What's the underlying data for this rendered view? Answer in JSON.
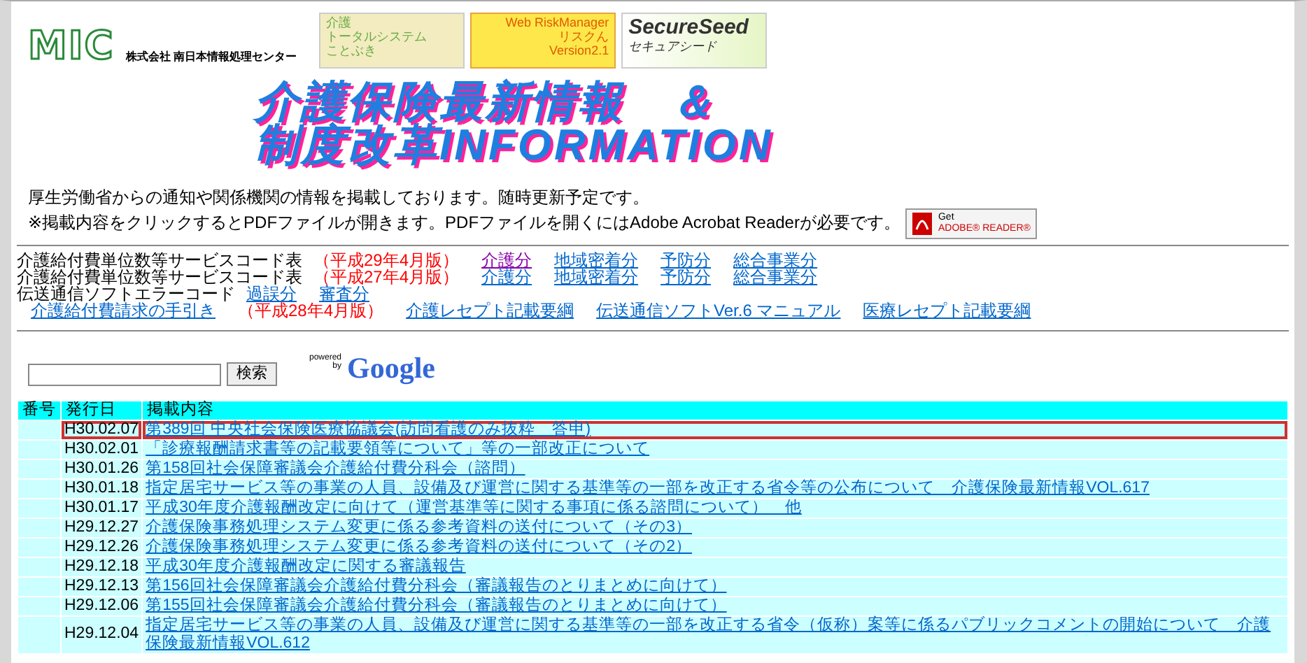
{
  "header": {
    "logo": "MIC",
    "company": "株式会社 南日本情報処理センター",
    "banners": [
      {
        "kind": "care",
        "lines": [
          "介護",
          "トータルシステム",
          "ことぶき"
        ]
      },
      {
        "kind": "risk",
        "lines": [
          "Web RiskManager",
          "リスクん",
          "Version2.1"
        ]
      },
      {
        "kind": "secure",
        "lines": [
          "SecureSeed",
          "セキュアシード"
        ]
      }
    ]
  },
  "title_lines": [
    "介護保険最新情報　＆",
    "制度改革INFORMATION"
  ],
  "notices": [
    "厚生労働省からの通知や関係機関の情報を掲載しております。随時更新予定です。",
    "※掲載内容をクリックするとPDFファイルが開きます。PDFファイルを開くにはAdobe Acrobat Readerが必要です。"
  ],
  "reader_badge": {
    "line_1": "Get",
    "line_2": "ADOBE® READER®"
  },
  "link_rows": [
    {
      "indent": false,
      "items": [
        {
          "kind": "label",
          "text": "介護給付費単位数等サービスコード表"
        },
        {
          "kind": "edition",
          "text": "（平成29年4月版）"
        },
        {
          "kind": "link",
          "text": "介護分",
          "visited": true
        },
        {
          "kind": "link",
          "text": "地域密着分",
          "visited": false
        },
        {
          "kind": "link",
          "text": "予防分",
          "visited": false
        },
        {
          "kind": "link",
          "text": "総合事業分",
          "visited": false
        }
      ]
    },
    {
      "indent": false,
      "items": [
        {
          "kind": "label",
          "text": "介護給付費単位数等サービスコード表"
        },
        {
          "kind": "edition",
          "text": "（平成27年4月版）"
        },
        {
          "kind": "link",
          "text": "介護分",
          "visited": false
        },
        {
          "kind": "link",
          "text": "地域密着分",
          "visited": false
        },
        {
          "kind": "link",
          "text": "予防分",
          "visited": false
        },
        {
          "kind": "link",
          "text": "総合事業分",
          "visited": false
        }
      ]
    },
    {
      "indent": false,
      "items": [
        {
          "kind": "label",
          "text": "伝送通信ソフトエラーコード"
        },
        {
          "kind": "link",
          "text": "過誤分",
          "visited": false
        },
        {
          "kind": "link",
          "text": "審査分",
          "visited": false
        }
      ]
    },
    {
      "indent": true,
      "items": [
        {
          "kind": "link",
          "text": "介護給付費請求の手引き",
          "visited": false
        },
        {
          "kind": "edition",
          "text": "（平成28年4月版）"
        },
        {
          "kind": "link",
          "text": "介護レセプト記載要綱",
          "visited": false
        },
        {
          "kind": "link",
          "text": "伝送通信ソフトVer.6 マニュアル",
          "visited": false
        },
        {
          "kind": "link",
          "text": "医療レセプト記載要綱",
          "visited": false
        }
      ]
    }
  ],
  "search": {
    "button": "検索",
    "powered": "powered by",
    "brand": "Google"
  },
  "table": {
    "columns": [
      "番号",
      "発行日",
      "掲載内容"
    ],
    "rows": [
      {
        "date": "H30.02.07",
        "title": "第389回 中央社会保険医療協議会(訪問看護のみ抜粋　答申)",
        "highlighted": true
      },
      {
        "date": "H30.02.01",
        "title": "「診療報酬請求書等の記載要領等について」等の一部改正について",
        "highlighted": false
      },
      {
        "date": "H30.01.26",
        "title": "第158回社会保障審議会介護給付費分科会（諮問）",
        "highlighted": false
      },
      {
        "date": "H30.01.18",
        "title": "指定居宅サービス等の事業の人員、設備及び運営に関する基準等の一部を改正する省令等の公布について　介護保険最新情報VOL.617",
        "highlighted": false
      },
      {
        "date": "H30.01.17",
        "title": "平成30年度介護報酬改定に向けて（運営基準等に関する事項に係る諮問について）　他",
        "highlighted": false
      },
      {
        "date": "H29.12.27",
        "title": "介護保険事務処理システム変更に係る参考資料の送付について（その3）",
        "highlighted": false
      },
      {
        "date": "H29.12.26",
        "title": "介護保険事務処理システム変更に係る参考資料の送付について（その2）",
        "highlighted": false
      },
      {
        "date": "H29.12.18",
        "title": "平成30年度介護報酬改定に関する審議報告",
        "highlighted": false
      },
      {
        "date": "H29.12.13",
        "title": "第156回社会保障審議会介護給付費分科会（審議報告のとりまとめに向けて）",
        "highlighted": false
      },
      {
        "date": "H29.12.06",
        "title": "第155回社会保障審議会介護給付費分科会（審議報告のとりまとめに向けて）",
        "highlighted": false
      },
      {
        "date": "H29.12.04",
        "title": "指定居宅サービス等の事業の人員、設備及び運営に関する基準等の一部を改正する省令（仮称）案等に係るパブリックコメントの開始について　介護保険最新情報VOL.612",
        "highlighted": false
      }
    ]
  }
}
